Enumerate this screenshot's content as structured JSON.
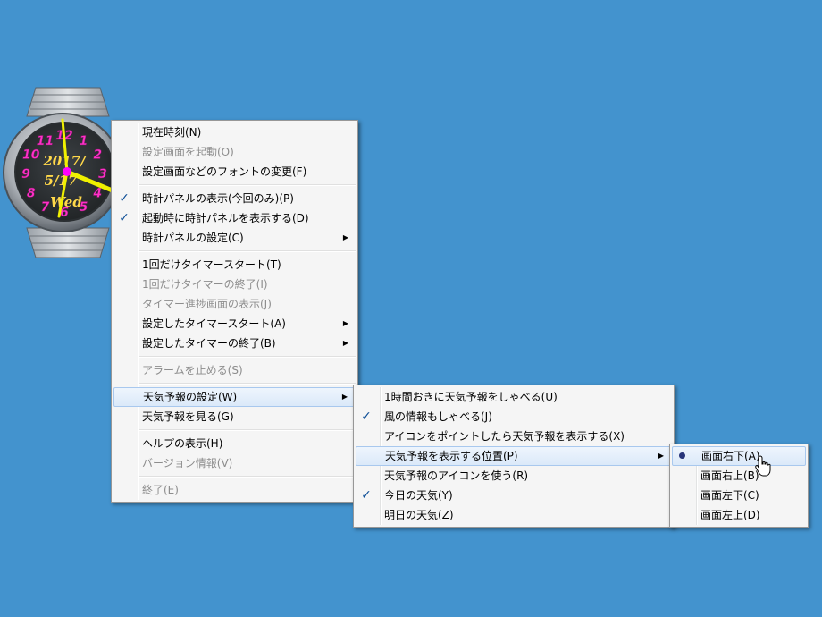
{
  "clock": {
    "numbers": [
      "12",
      "1",
      "2",
      "3",
      "4",
      "5",
      "6",
      "7",
      "8",
      "9",
      "10",
      "11"
    ],
    "date_year": "2017/",
    "date_day": "5/17",
    "weekday": "Wed"
  },
  "main_menu": [
    {
      "label": "現在時刻(N)"
    },
    {
      "label": "設定画面を起動(O)",
      "disabled": true
    },
    {
      "label": "設定画面などのフォントの変更(F)"
    },
    {
      "sep": true
    },
    {
      "label": "時計パネルの表示(今回のみ)(P)",
      "checked": true
    },
    {
      "label": "起動時に時計パネルを表示する(D)",
      "checked": true
    },
    {
      "label": "時計パネルの設定(C)",
      "submenu": true
    },
    {
      "sep": true
    },
    {
      "label": "1回だけタイマースタート(T)"
    },
    {
      "label": "1回だけタイマーの終了(I)",
      "disabled": true
    },
    {
      "label": "タイマー進捗画面の表示(J)",
      "disabled": true
    },
    {
      "label": "設定したタイマースタート(A)",
      "submenu": true
    },
    {
      "label": "設定したタイマーの終了(B)",
      "submenu": true
    },
    {
      "sep": true
    },
    {
      "label": "アラームを止める(S)",
      "disabled": true
    },
    {
      "sep": true
    },
    {
      "label": "天気予報の設定(W)",
      "submenu": true,
      "highlight": true
    },
    {
      "label": "天気予報を見る(G)"
    },
    {
      "sep": true
    },
    {
      "label": "ヘルプの表示(H)"
    },
    {
      "label": "バージョン情報(V)",
      "disabled": true
    },
    {
      "sep": true
    },
    {
      "label": "終了(E)",
      "disabled": true
    }
  ],
  "weather_menu": [
    {
      "label": "1時間おきに天気予報をしゃべる(U)"
    },
    {
      "label": "風の情報もしゃべる(J)",
      "checked": true
    },
    {
      "label": "アイコンをポイントしたら天気予報を表示する(X)"
    },
    {
      "label": "天気予報を表示する位置(P)",
      "submenu": true,
      "highlight": true
    },
    {
      "label": "天気予報のアイコンを使う(R)"
    },
    {
      "label": "今日の天気(Y)",
      "checked": true
    },
    {
      "label": "明日の天気(Z)"
    }
  ],
  "position_menu": [
    {
      "label": "画面右下(A)",
      "radio": true,
      "highlight": true
    },
    {
      "label": "画面右上(B)"
    },
    {
      "label": "画面左下(C)"
    },
    {
      "label": "画面左上(D)"
    }
  ],
  "glyphs": {
    "check": "✓",
    "arrow": "▶"
  },
  "colors": {
    "desktop": "#4393ce",
    "clock_numbers": "#ff30c8",
    "clock_hands": "#f0f000",
    "check": "#0c4d96"
  }
}
